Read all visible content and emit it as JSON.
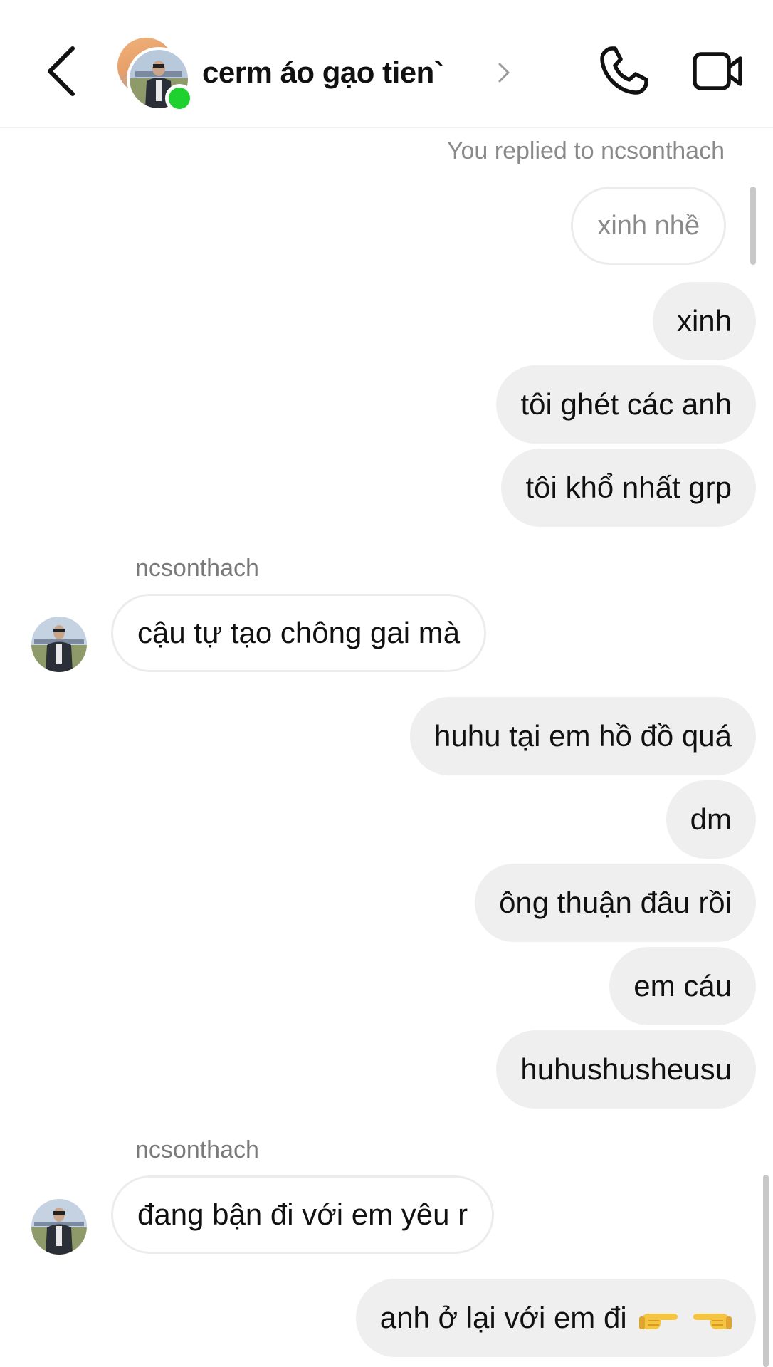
{
  "header": {
    "title": "cerm áo gạo tien`",
    "online": true,
    "icons": {
      "back": "chevron-left-icon",
      "title_chevron": "chevron-right-icon",
      "call": "phone-icon",
      "video": "video-camera-icon"
    }
  },
  "thread": {
    "reply_note": "You replied to ncsonthach",
    "quoted_message": "xinh nhề",
    "messages": [
      {
        "from": "me",
        "text": "xinh"
      },
      {
        "from": "me",
        "text": "tôi ghét các anh"
      },
      {
        "from": "me",
        "text": "tôi khổ nhất grp"
      },
      {
        "from": "ncsonthach",
        "sender_label": "ncsonthach",
        "text": "cậu tự tạo chông gai mà"
      },
      {
        "from": "me",
        "text": "huhu tại em hồ đồ quá"
      },
      {
        "from": "me",
        "text": "dm"
      },
      {
        "from": "me",
        "text": "ông thuận đâu rồi"
      },
      {
        "from": "me",
        "text": "em cáu"
      },
      {
        "from": "me",
        "text": "huhushusheusu"
      },
      {
        "from": "ncsonthach",
        "sender_label": "ncsonthach",
        "text": "đang bận đi với em yêu r"
      },
      {
        "from": "me",
        "text": "anh ở lại với em đi",
        "emoji": [
          "pointing-right-hand",
          "pointing-left-hand"
        ]
      }
    ]
  },
  "colors": {
    "outgoing_bubble": "#efefef",
    "incoming_border": "#ececec",
    "online": "#1fd12e",
    "muted_text": "#8a8a8a"
  }
}
